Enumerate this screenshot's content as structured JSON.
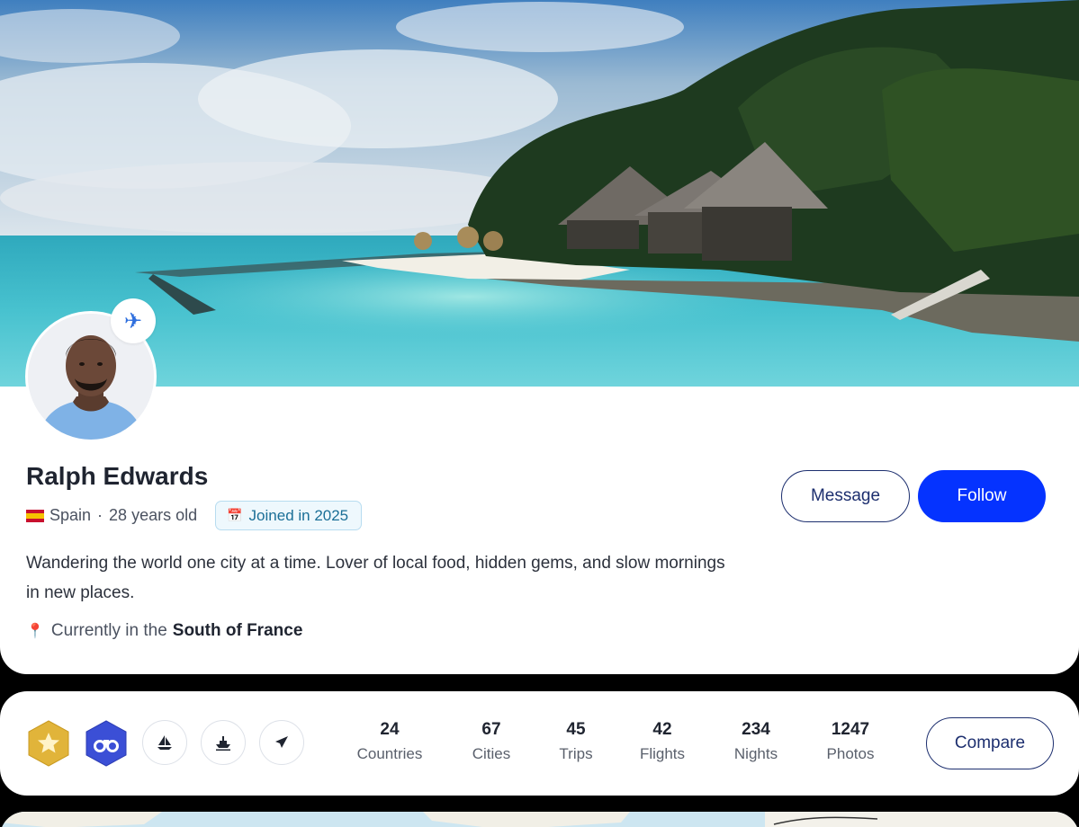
{
  "profile": {
    "name": "Ralph Edwards",
    "country": "Spain",
    "age_text": "28 years old",
    "joined_label": "Joined in 2025",
    "bio": "Wandering the world one city at a time. Lover of local food, hidden gems, and slow mornings in new places.",
    "location_prefix": "Currently in the",
    "location_place": "South of France",
    "avatar_badge_icon": "airplane-icon",
    "cover_image": "tropical-beach-bungalows"
  },
  "actions": {
    "message_label": "Message",
    "follow_label": "Follow",
    "compare_label": "Compare"
  },
  "badges": [
    {
      "icon": "star-icon",
      "style": "gold-hexagon"
    },
    {
      "icon": "binoculars-icon",
      "style": "blue-hexagon"
    },
    {
      "icon": "sailboat-icon",
      "style": "circle"
    },
    {
      "icon": "ship-icon",
      "style": "circle"
    },
    {
      "icon": "airplane-icon",
      "style": "circle"
    }
  ],
  "stats": [
    {
      "value": "24",
      "label": "Countries"
    },
    {
      "value": "67",
      "label": "Cities"
    },
    {
      "value": "45",
      "label": "Trips"
    },
    {
      "value": "42",
      "label": "Flights"
    },
    {
      "value": "234",
      "label": "Nights"
    },
    {
      "value": "1247",
      "label": "Photos"
    }
  ],
  "colors": {
    "accent": "#0533ff",
    "outline": "#1d2f6f",
    "joined_badge_bg": "#eef8fd",
    "joined_badge_text": "#1b6f97",
    "gold_badge": "#e1b43a",
    "blue_badge": "#3b4fd6"
  }
}
